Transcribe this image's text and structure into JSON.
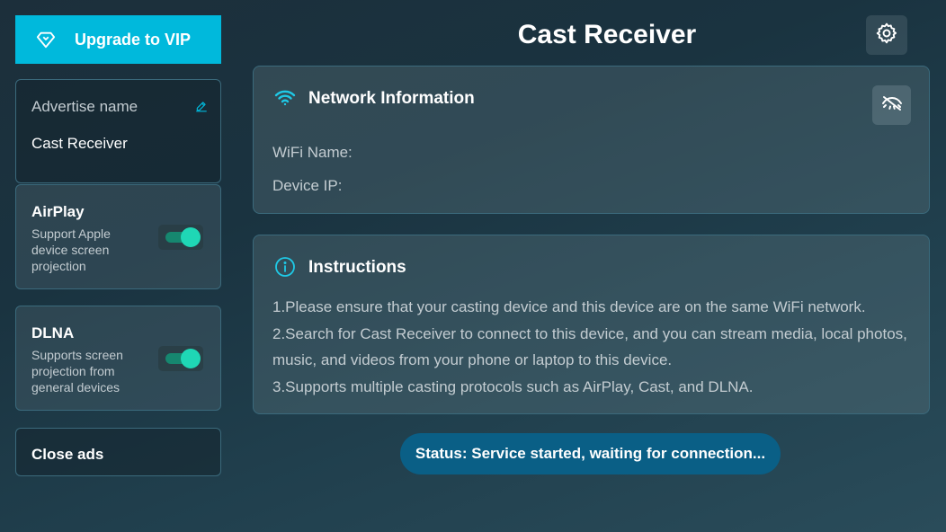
{
  "sidebar": {
    "upgrade_label": "Upgrade to VIP",
    "advertise": {
      "title": "Advertise name",
      "value": "Cast Receiver"
    },
    "airplay": {
      "name": "AirPlay",
      "description": "Support Apple device screen projection",
      "enabled": true
    },
    "dlna": {
      "name": "DLNA",
      "description": "Supports screen projection from general devices",
      "enabled": true
    },
    "close_ads_label": "Close ads"
  },
  "header": {
    "title": "Cast Receiver"
  },
  "network": {
    "title": "Network Information",
    "wifi_label": "WiFi Name:",
    "ip_label": "Device IP:"
  },
  "instructions": {
    "title": "Instructions",
    "lines": [
      "1.Please ensure that your casting device and this device are on the same WiFi network.",
      "2.Search for Cast Receiver to connect to this device, and you can stream media, local photos, music, and videos from your phone or laptop to this device.",
      "3.Supports multiple casting protocols such as AirPlay, Cast, and DLNA."
    ]
  },
  "status": {
    "text": "Status: Service started, waiting for connection..."
  },
  "colors": {
    "accent": "#00b9dc",
    "toggle_on": "#1fd7b5",
    "status_bg": "#0a5f86"
  },
  "icons": {
    "upgrade": "diamond-icon",
    "edit": "pencil-icon",
    "settings": "gear-icon",
    "network": "wifi-icon",
    "visibility": "eye-off-icon",
    "instructions": "info-icon"
  }
}
